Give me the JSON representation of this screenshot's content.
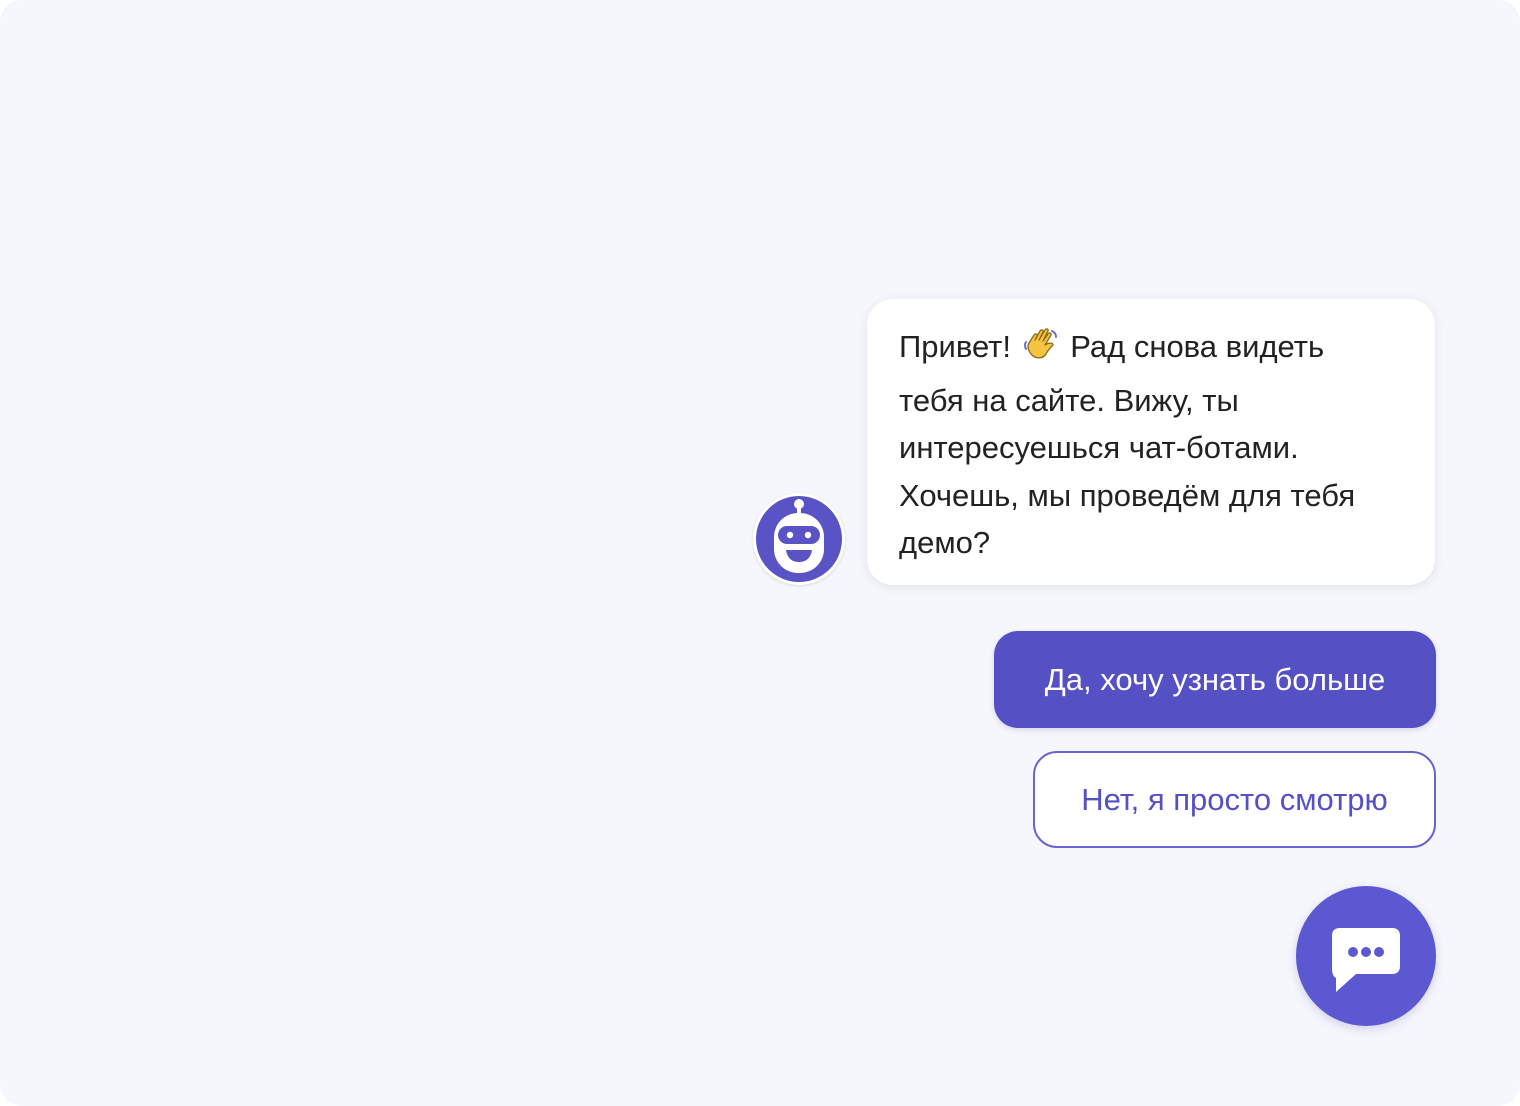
{
  "chat": {
    "bot_message": {
      "line1_before": "Привет!",
      "line1_emoji": "waving-hand-icon",
      "line1_after": "Рад снова видеть",
      "line2": "тебя на сайте. Вижу, ты",
      "line3": "интересуешься чат-ботами.",
      "line4": "Хочешь, мы проведём для тебя",
      "line5": "демо?"
    },
    "quick_replies": {
      "yes_label": "Да, хочу узнать больше",
      "no_label": "Нет, я просто смотрю"
    }
  },
  "icons": {
    "avatar": "robot-icon",
    "launcher": "chat-bubble-icon"
  },
  "colors": {
    "accent": "#5550c4",
    "background": "#f6f7fc",
    "bubble": "#ffffff",
    "text": "#222222"
  }
}
